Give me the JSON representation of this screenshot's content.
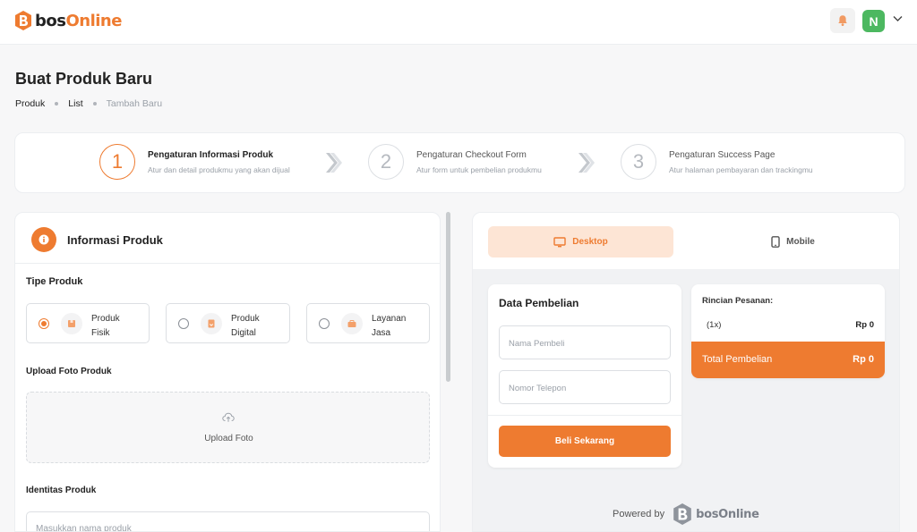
{
  "brand": {
    "name_prefix": "bos",
    "name_suffix": "Online",
    "accent": "#ee7b30"
  },
  "topbar": {
    "avatar_initial": "N",
    "avatar_color": "#4cb860",
    "icons": [
      "bell-icon",
      "chevron-down-icon"
    ]
  },
  "page": {
    "title": "Buat Produk Baru"
  },
  "breadcrumb": {
    "items": [
      "Produk",
      "List",
      "Tambah Baru"
    ]
  },
  "stepper": {
    "steps": [
      {
        "number": "1",
        "title": "Pengaturan Informasi Produk",
        "desc": "Atur dan detail produkmu yang akan dijual",
        "active": true
      },
      {
        "number": "2",
        "title": "Pengaturan Checkout Form",
        "desc": "Atur form untuk pembelian produkmu",
        "active": false
      },
      {
        "number": "3",
        "title": "Pengaturan Success Page",
        "desc": "Atur halaman pembayaran dan trackingmu",
        "active": false
      }
    ]
  },
  "form": {
    "header_title": "Informasi Produk",
    "tipe_label": "Tipe Produk",
    "types": [
      {
        "line1": "Produk",
        "line2": "Fisik",
        "selected": true,
        "icon": "box-icon"
      },
      {
        "line1": "Produk",
        "line2": "Digital",
        "selected": false,
        "icon": "digital-file-icon"
      },
      {
        "line1": "Layanan",
        "line2": "Jasa",
        "selected": false,
        "icon": "service-icon"
      }
    ],
    "upload_label": "Upload Foto Produk",
    "upload_button": "Upload Foto",
    "identity_label": "Identitas Produk",
    "name_placeholder": "Masukkan nama produk"
  },
  "preview": {
    "tabs": [
      {
        "label": "Desktop",
        "icon": "desktop-icon",
        "active": true
      },
      {
        "label": "Mobile",
        "icon": "mobile-icon",
        "active": false
      }
    ],
    "purchase": {
      "title": "Data Pembelian",
      "name_placeholder": "Nama Pembeli",
      "phone_placeholder": "Nomor Telepon",
      "buy_button": "Beli Sekarang"
    },
    "order": {
      "title": "Rincian Pesanan:",
      "qty": "(1x)",
      "price": "Rp 0",
      "total_label": "Total Pembelian",
      "total_amount": "Rp 0"
    },
    "powered_by": "Powered by",
    "powered_logo": "bosOnline"
  }
}
